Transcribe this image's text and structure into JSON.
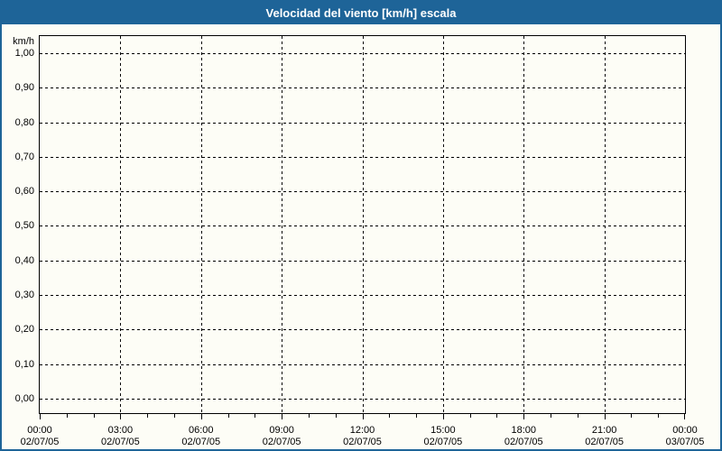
{
  "window": {
    "title": "Velocidad del viento [km/h] escala"
  },
  "colors": {
    "titlebar_bg": "#1e6498",
    "frame_border": "#1e6498",
    "title_text": "#ffffff",
    "page_bg": "#fdfdf6",
    "axis_color": "#000000",
    "grid_color": "#000000",
    "label_color": "#000000"
  },
  "chart_data": {
    "type": "line",
    "title": "Velocidad del viento [km/h] escala",
    "xlabel": "",
    "ylabel": "km/h",
    "ylim": [
      0.0,
      1.0
    ],
    "y_tick_labels": [
      "1,00",
      "0,90",
      "0,80",
      "0,70",
      "0,60",
      "0,50",
      "0,40",
      "0,30",
      "0,20",
      "0,10",
      "0,00"
    ],
    "x_tick_labels": [
      {
        "time": "00:00",
        "date": "02/07/05"
      },
      {
        "time": "03:00",
        "date": "02/07/05"
      },
      {
        "time": "06:00",
        "date": "02/07/05"
      },
      {
        "time": "09:00",
        "date": "02/07/05"
      },
      {
        "time": "12:00",
        "date": "02/07/05"
      },
      {
        "time": "15:00",
        "date": "02/07/05"
      },
      {
        "time": "18:00",
        "date": "02/07/05"
      },
      {
        "time": "21:00",
        "date": "02/07/05"
      },
      {
        "time": "00:00",
        "date": "03/07/05"
      }
    ],
    "x_minor_ticks_per_major_interval": 3,
    "grid": "dashed, horizontal and vertical, on",
    "legend": "none",
    "series": []
  }
}
